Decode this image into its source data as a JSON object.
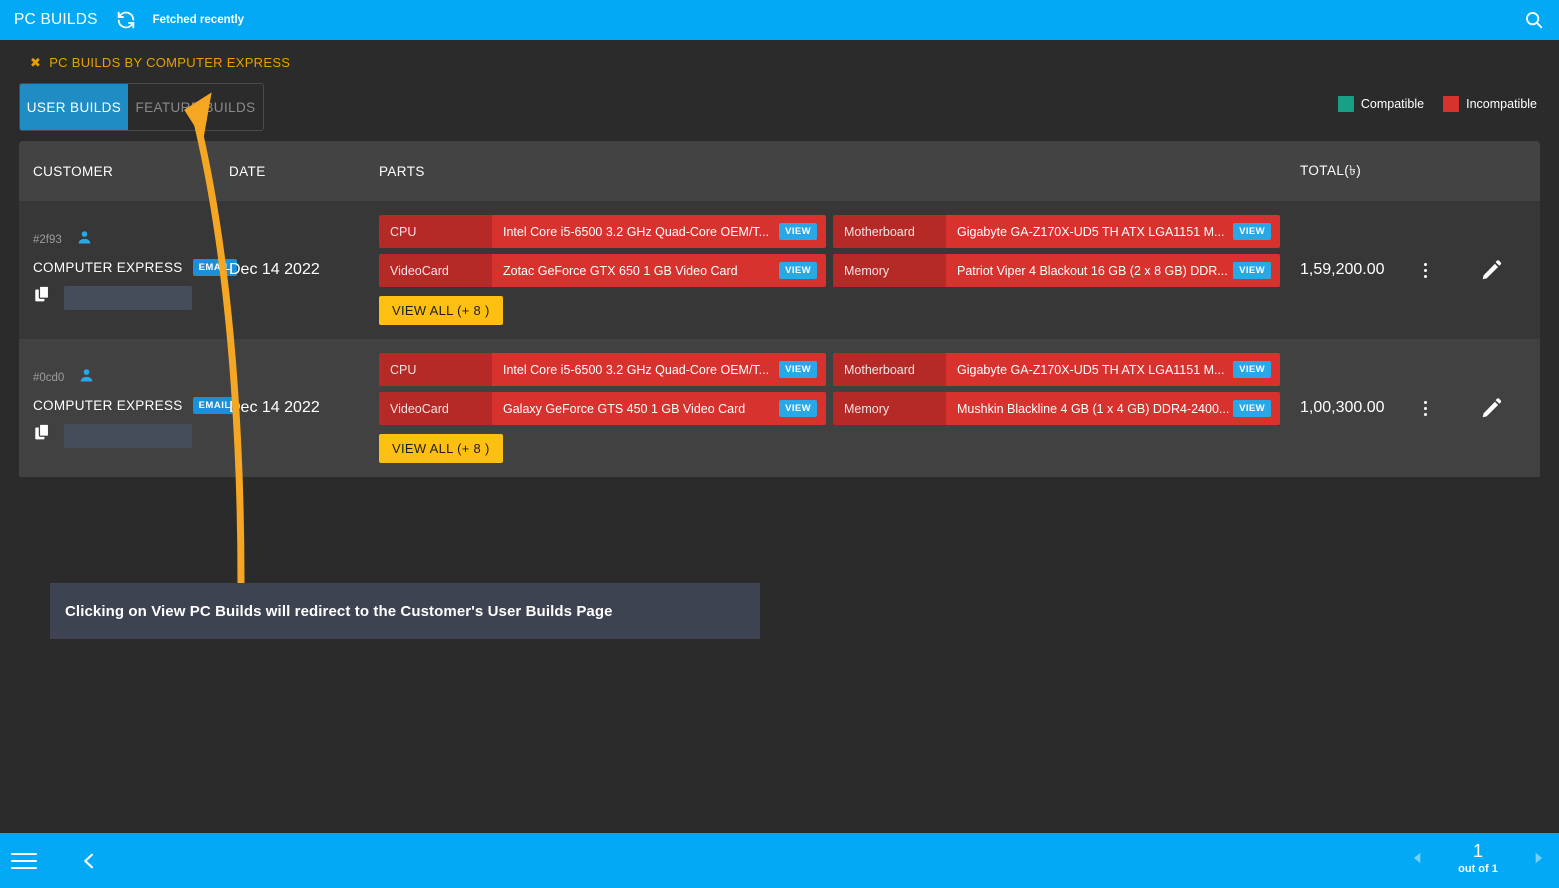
{
  "topbar": {
    "title": "PC BUILDS",
    "sync_icon": "sync-refresh-icon",
    "fetch_status": "Fetched recently",
    "search_icon": "search-icon",
    "background": "#03a9f4"
  },
  "breadcrumb": {
    "close_icon": "close-x-icon",
    "label": "PC BUILDS BY COMPUTER EXPRESS",
    "color": "#e8a000"
  },
  "tabs": [
    {
      "label": "USER BUILDS",
      "active": true
    },
    {
      "label": "FEATURE BUILDS",
      "active": false
    }
  ],
  "legend": [
    {
      "label": "Compatible",
      "color": "#18a085"
    },
    {
      "label": "Incompatible",
      "color": "#d8322f"
    }
  ],
  "table": {
    "headers": {
      "customer": "CUSTOMER",
      "date": "DATE",
      "parts": "PARTS",
      "total": "TOTAL(৳)"
    },
    "rows": [
      {
        "customer": {
          "id": "#2f93",
          "person_icon": "person-icon",
          "name": "COMPUTER EXPRESS",
          "email_badge": "EMAIL",
          "copy_icon": "copy-icon",
          "redacted_value": ""
        },
        "date": "Dec 14 2022",
        "parts": [
          {
            "label": "CPU",
            "value": "Intel Core i5-6500 3.2 GHz Quad-Core OEM/T...",
            "view": "VIEW",
            "status": "incompatible"
          },
          {
            "label": "Motherboard",
            "value": "Gigabyte GA-Z170X-UD5 TH ATX LGA1151 M...",
            "view": "VIEW",
            "status": "incompatible"
          },
          {
            "label": "VideoCard",
            "value": "Zotac GeForce GTX 650 1 GB Video Card",
            "view": "VIEW",
            "status": "incompatible"
          },
          {
            "label": "Memory",
            "value": "Patriot Viper 4 Blackout 16 GB (2 x 8 GB) DDR...",
            "view": "VIEW",
            "status": "incompatible"
          }
        ],
        "view_all": "VIEW ALL (+ 8 )",
        "total": "1,59,200.00",
        "menu_icon": "kebab-menu-icon",
        "edit_icon": "pencil-edit-icon"
      },
      {
        "customer": {
          "id": "#0cd0",
          "person_icon": "person-icon",
          "name": "COMPUTER EXPRESS",
          "email_badge": "EMAIL",
          "copy_icon": "copy-icon",
          "redacted_value": ""
        },
        "date": "Dec 14 2022",
        "parts": [
          {
            "label": "CPU",
            "value": "Intel Core i5-6500 3.2 GHz Quad-Core OEM/T...",
            "view": "VIEW",
            "status": "incompatible"
          },
          {
            "label": "Motherboard",
            "value": "Gigabyte GA-Z170X-UD5 TH ATX LGA1151 M...",
            "view": "VIEW",
            "status": "incompatible"
          },
          {
            "label": "VideoCard",
            "value": "Galaxy GeForce GTS 450 1 GB Video Card",
            "view": "VIEW",
            "status": "incompatible"
          },
          {
            "label": "Memory",
            "value": "Mushkin Blackline 4 GB (1 x 4 GB) DDR4-2400...",
            "view": "VIEW",
            "status": "incompatible"
          }
        ],
        "view_all": "VIEW ALL (+ 8 )",
        "total": "1,00,300.00",
        "menu_icon": "kebab-menu-icon",
        "edit_icon": "pencil-edit-icon"
      }
    ]
  },
  "annotation": {
    "text": "Clicking on View PC Builds will redirect to the Customer's User Builds Page",
    "arrow_color": "#f5a623",
    "box_color": "#3d4350"
  },
  "bottombar": {
    "menu_icon": "hamburger-menu-icon",
    "back_icon": "chevron-left-icon",
    "prev_icon": "pager-prev-icon",
    "next_icon": "pager-next-icon",
    "page_number": "1",
    "page_of": "out of 1",
    "background": "#03a9f4"
  }
}
